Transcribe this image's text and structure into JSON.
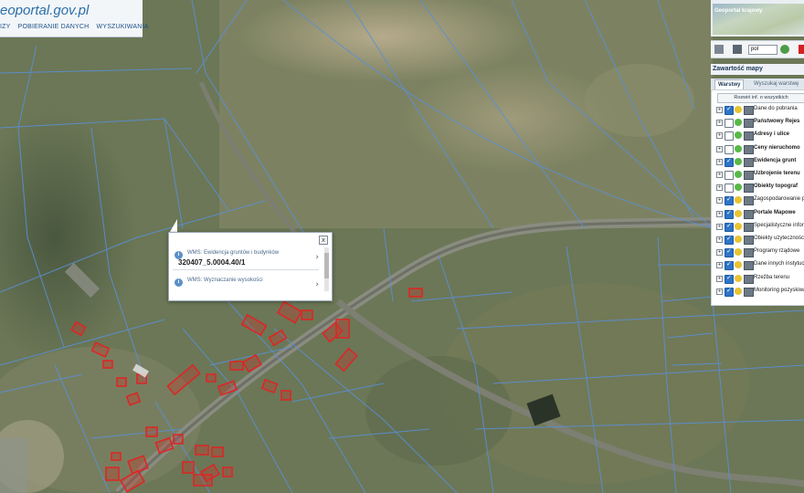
{
  "header": {
    "logo": "eoportal.gov.pl",
    "nav_links": [
      "IZY",
      "POBIERANIE DANYCH",
      "WYSZUKIWANIA"
    ]
  },
  "popup": {
    "items": [
      {
        "title": "WMS: Ewidencja gruntów i budynków",
        "value": "320407_5.0004.40/1"
      },
      {
        "title": "WMS: Wyznaczanie wysokości",
        "value": ""
      }
    ],
    "close": "x"
  },
  "panel": {
    "title": "Geoportal krajowy",
    "lang": "pol",
    "section_title": "Zawartość mapy",
    "tabs": [
      {
        "label": "Warstwy",
        "active": true
      },
      {
        "label": "Wyszukaj warstwę",
        "active": false
      }
    ],
    "expand_all": "Rozwiń inf. o wszystkich",
    "layers": [
      {
        "label": "Dane do pobrania",
        "checked": true,
        "bold": false,
        "status": "yellow"
      },
      {
        "label": "Państwowy Rejes",
        "checked": false,
        "bold": true,
        "status": "green"
      },
      {
        "label": "Adresy i ulice",
        "checked": false,
        "bold": true,
        "status": "green"
      },
      {
        "label": "Ceny nieruchomo",
        "checked": false,
        "bold": true,
        "status": "green"
      },
      {
        "label": "Ewidencja grunt",
        "checked": true,
        "bold": true,
        "status": "green"
      },
      {
        "label": "Uzbrojenie terenu",
        "checked": false,
        "bold": true,
        "status": "green"
      },
      {
        "label": "Obiekty topograf",
        "checked": false,
        "bold": true,
        "status": "green"
      },
      {
        "label": "Zagospodarowanie prz",
        "checked": true,
        "bold": false,
        "status": "yellow"
      },
      {
        "label": "Portale Mapowe",
        "checked": true,
        "bold": true,
        "status": "yellow"
      },
      {
        "label": "Specjalistyczne inform",
        "checked": true,
        "bold": false,
        "status": "yellow"
      },
      {
        "label": "Obiekty użyteczności p",
        "checked": true,
        "bold": false,
        "status": "yellow"
      },
      {
        "label": "Programy rządowe",
        "checked": true,
        "bold": false,
        "status": "yellow"
      },
      {
        "label": "Dane innych instytucji",
        "checked": true,
        "bold": false,
        "status": "yellow"
      },
      {
        "label": "Rzeźba terenu",
        "checked": true,
        "bold": false,
        "status": "yellow"
      },
      {
        "label": "Monitoring pozyskiwan",
        "checked": true,
        "bold": false,
        "status": "yellow"
      }
    ]
  },
  "colors": {
    "parcel_line": "#5b8fd6",
    "building_outline": "#e02424",
    "field_base": "#6b7756"
  }
}
